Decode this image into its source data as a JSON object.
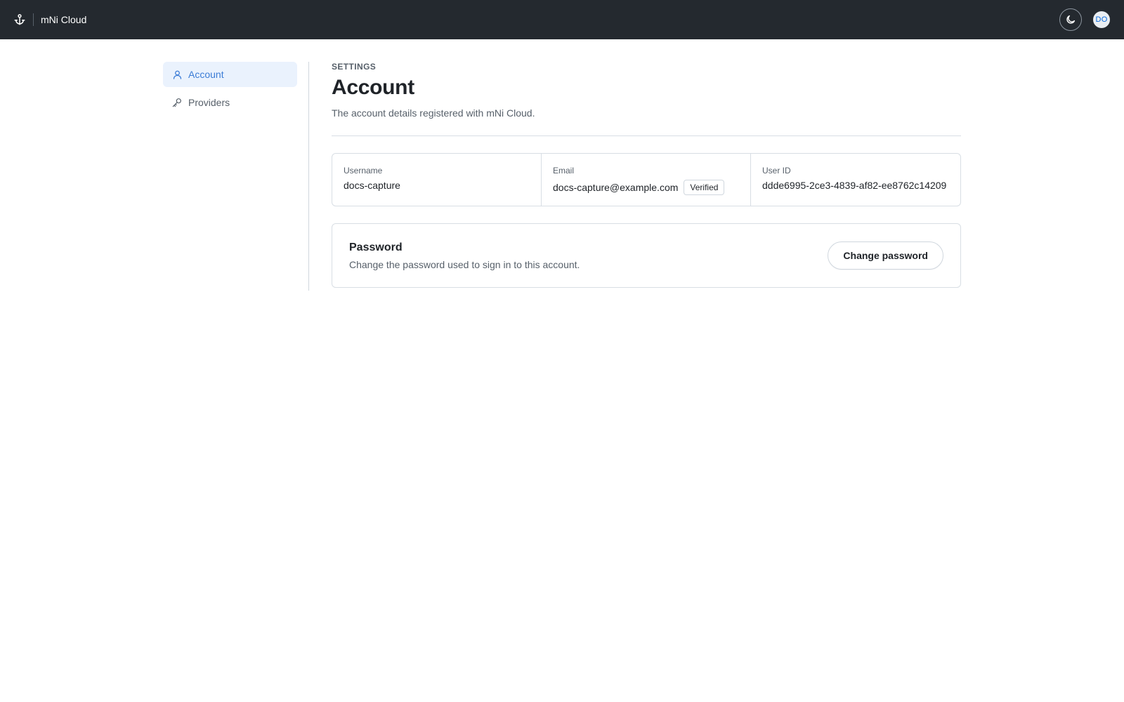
{
  "header": {
    "app_name": "mNi Cloud",
    "logo_icon": "anchor-icon",
    "theme_icon": "moon-icon",
    "avatar_initials": "DO"
  },
  "sidebar": {
    "items": [
      {
        "label": "Account",
        "icon": "user-icon",
        "active": true
      },
      {
        "label": "Providers",
        "icon": "key-icon",
        "active": false
      }
    ]
  },
  "main": {
    "eyebrow": "SETTINGS",
    "title": "Account",
    "description": "The account details registered with mNi Cloud.",
    "fields": {
      "username": {
        "label": "Username",
        "value": "docs-capture"
      },
      "email": {
        "label": "Email",
        "value": "docs-capture@example.com",
        "badge": "Verified"
      },
      "user_id": {
        "label": "User ID",
        "value": "ddde6995-2ce3-4839-af82-ee8762c14209"
      }
    },
    "password": {
      "title": "Password",
      "description": "Change the password used to sign in to this account.",
      "button_label": "Change password"
    }
  },
  "colors": {
    "topbar": "#24292f",
    "accent": "#3b7cd6",
    "active_nav_bg": "#eaf2fd"
  }
}
